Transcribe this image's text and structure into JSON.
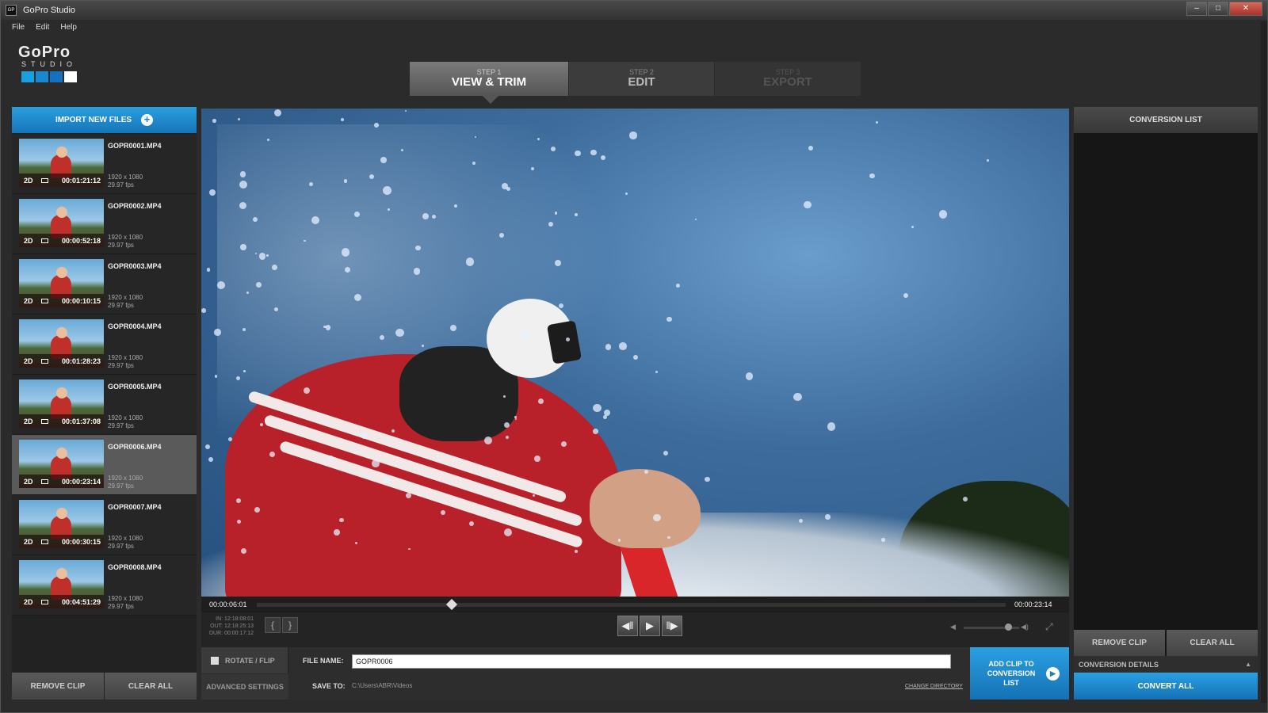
{
  "window": {
    "title": "GoPro Studio",
    "controls": [
      "–",
      "□",
      "✕"
    ]
  },
  "menu": [
    "File",
    "Edit",
    "Help"
  ],
  "logo": {
    "text": "GoPro",
    "sub": "STUDIO",
    "colors": [
      "#1aa0e0",
      "#1a88d0",
      "#1670c0",
      "#ffffff"
    ]
  },
  "steps": [
    {
      "num": "STEP 1",
      "label": "VIEW & TRIM",
      "active": true
    },
    {
      "num": "STEP 2",
      "label": "EDIT",
      "active": false
    },
    {
      "num": "STEP 3",
      "label": "EXPORT",
      "active": false
    }
  ],
  "import_button": "IMPORT NEW FILES",
  "clips": [
    {
      "name": "GOPR0001.MP4",
      "mode": "2D",
      "duration": "00:01:21:12",
      "resolution": "1920 x 1080",
      "fps": "29.97 fps",
      "selected": false
    },
    {
      "name": "GOPR0002.MP4",
      "mode": "2D",
      "duration": "00:00:52:18",
      "resolution": "1920 x 1080",
      "fps": "29.97 fps",
      "selected": false
    },
    {
      "name": "GOPR0003.MP4",
      "mode": "2D",
      "duration": "00:00:10:15",
      "resolution": "1920 x 1080",
      "fps": "29.97 fps",
      "selected": false
    },
    {
      "name": "GOPR0004.MP4",
      "mode": "2D",
      "duration": "00:01:28:23",
      "resolution": "1920 x 1080",
      "fps": "29.97 fps",
      "selected": false
    },
    {
      "name": "GOPR0005.MP4",
      "mode": "2D",
      "duration": "00:01:37:08",
      "resolution": "1920 x 1080",
      "fps": "29.97 fps",
      "selected": false
    },
    {
      "name": "GOPR0006.MP4",
      "mode": "2D",
      "duration": "00:00:23:14",
      "resolution": "1920 x 1080",
      "fps": "29.97 fps",
      "selected": true
    },
    {
      "name": "GOPR0007.MP4",
      "mode": "2D",
      "duration": "00:00:30:15",
      "resolution": "1920 x 1080",
      "fps": "29.97 fps",
      "selected": false
    },
    {
      "name": "GOPR0008.MP4",
      "mode": "2D",
      "duration": "00:04:51:29",
      "resolution": "1920 x 1080",
      "fps": "29.97 fps",
      "selected": false
    }
  ],
  "left_buttons": {
    "remove": "REMOVE CLIP",
    "clear": "CLEAR ALL"
  },
  "player": {
    "current_time": "00:00:06:01",
    "total_time": "00:00:23:14",
    "playhead_fraction": 0.26,
    "trim_in": "IN: 12:18:08:01",
    "trim_out": "OUT: 12:18:25:13",
    "trim_dur": "DUR: 00:00:17:12",
    "volume_fraction": 0.8
  },
  "bottom": {
    "rotate_flip": "ROTATE / FLIP",
    "advanced": "ADVANCED SETTINGS",
    "file_name_label": "FILE NAME:",
    "file_name_value": "GOPR0006",
    "save_to_label": "SAVE TO:",
    "save_to_path": "C:\\Users\\ABR\\Videos",
    "change_directory": "CHANGE DIRECTORY",
    "add_clip": "ADD CLIP TO CONVERSION LIST"
  },
  "right_panel": {
    "header": "CONVERSION LIST",
    "remove": "REMOVE CLIP",
    "clear": "CLEAR ALL",
    "details": "CONVERSION DETAILS",
    "convert_all": "CONVERT ALL"
  }
}
